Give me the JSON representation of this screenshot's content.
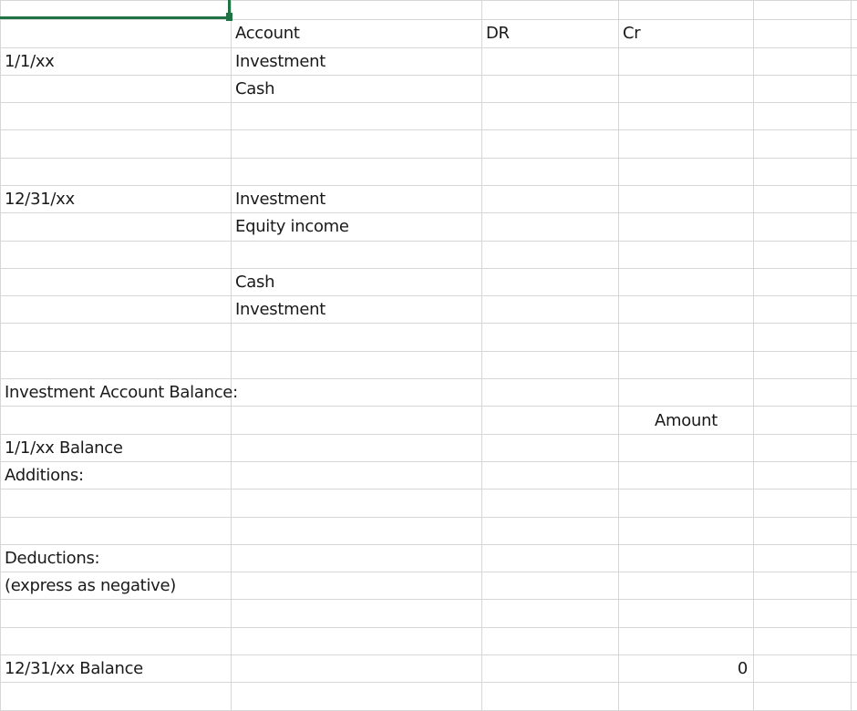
{
  "sheet": {
    "headers": {
      "account": "Account",
      "dr": "DR",
      "cr": "Cr"
    },
    "entries": {
      "date1": "1/1/xx",
      "r1_account": "Investment",
      "r2_account": "Cash",
      "date2": "12/31/xx",
      "r5_account": "Investment",
      "r6_account": "Equity income",
      "r8_account": "Cash",
      "r9_account": "Investment"
    },
    "balance_section": {
      "title": "Investment Account Balance:",
      "amount_header": "Amount",
      "opening": "1/1/xx Balance",
      "additions": "Additions:",
      "deductions": "Deductions:",
      "deductions_note": "(express as negative)",
      "closing": "12/31/xx Balance",
      "closing_value": "0"
    }
  },
  "colors": {
    "selection": "#217346",
    "gridline": "#d6d6d6"
  }
}
